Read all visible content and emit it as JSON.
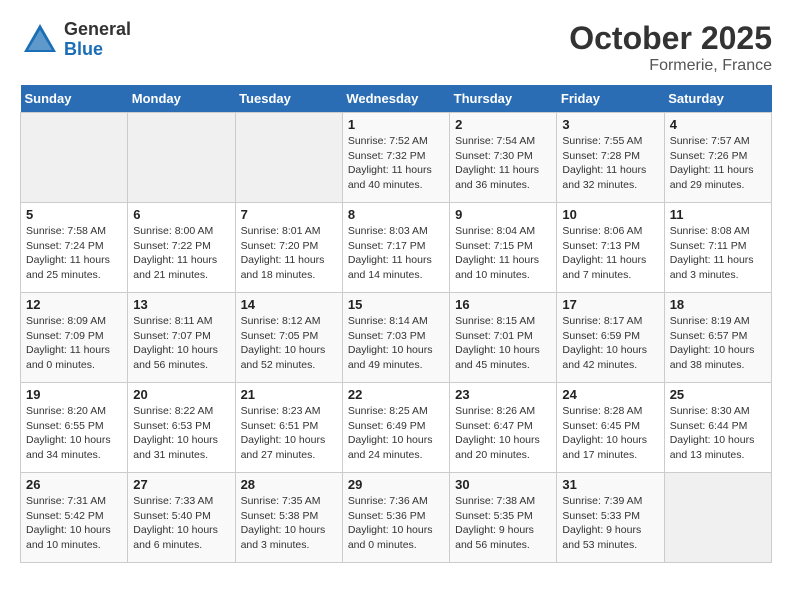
{
  "header": {
    "logo_line1": "General",
    "logo_line2": "Blue",
    "month_title": "October 2025",
    "location": "Formerie, France"
  },
  "calendar": {
    "weekdays": [
      "Sunday",
      "Monday",
      "Tuesday",
      "Wednesday",
      "Thursday",
      "Friday",
      "Saturday"
    ],
    "weeks": [
      [
        {
          "day": "",
          "info": ""
        },
        {
          "day": "",
          "info": ""
        },
        {
          "day": "",
          "info": ""
        },
        {
          "day": "1",
          "info": "Sunrise: 7:52 AM\nSunset: 7:32 PM\nDaylight: 11 hours and 40 minutes."
        },
        {
          "day": "2",
          "info": "Sunrise: 7:54 AM\nSunset: 7:30 PM\nDaylight: 11 hours and 36 minutes."
        },
        {
          "day": "3",
          "info": "Sunrise: 7:55 AM\nSunset: 7:28 PM\nDaylight: 11 hours and 32 minutes."
        },
        {
          "day": "4",
          "info": "Sunrise: 7:57 AM\nSunset: 7:26 PM\nDaylight: 11 hours and 29 minutes."
        }
      ],
      [
        {
          "day": "5",
          "info": "Sunrise: 7:58 AM\nSunset: 7:24 PM\nDaylight: 11 hours and 25 minutes."
        },
        {
          "day": "6",
          "info": "Sunrise: 8:00 AM\nSunset: 7:22 PM\nDaylight: 11 hours and 21 minutes."
        },
        {
          "day": "7",
          "info": "Sunrise: 8:01 AM\nSunset: 7:20 PM\nDaylight: 11 hours and 18 minutes."
        },
        {
          "day": "8",
          "info": "Sunrise: 8:03 AM\nSunset: 7:17 PM\nDaylight: 11 hours and 14 minutes."
        },
        {
          "day": "9",
          "info": "Sunrise: 8:04 AM\nSunset: 7:15 PM\nDaylight: 11 hours and 10 minutes."
        },
        {
          "day": "10",
          "info": "Sunrise: 8:06 AM\nSunset: 7:13 PM\nDaylight: 11 hours and 7 minutes."
        },
        {
          "day": "11",
          "info": "Sunrise: 8:08 AM\nSunset: 7:11 PM\nDaylight: 11 hours and 3 minutes."
        }
      ],
      [
        {
          "day": "12",
          "info": "Sunrise: 8:09 AM\nSunset: 7:09 PM\nDaylight: 11 hours and 0 minutes."
        },
        {
          "day": "13",
          "info": "Sunrise: 8:11 AM\nSunset: 7:07 PM\nDaylight: 10 hours and 56 minutes."
        },
        {
          "day": "14",
          "info": "Sunrise: 8:12 AM\nSunset: 7:05 PM\nDaylight: 10 hours and 52 minutes."
        },
        {
          "day": "15",
          "info": "Sunrise: 8:14 AM\nSunset: 7:03 PM\nDaylight: 10 hours and 49 minutes."
        },
        {
          "day": "16",
          "info": "Sunrise: 8:15 AM\nSunset: 7:01 PM\nDaylight: 10 hours and 45 minutes."
        },
        {
          "day": "17",
          "info": "Sunrise: 8:17 AM\nSunset: 6:59 PM\nDaylight: 10 hours and 42 minutes."
        },
        {
          "day": "18",
          "info": "Sunrise: 8:19 AM\nSunset: 6:57 PM\nDaylight: 10 hours and 38 minutes."
        }
      ],
      [
        {
          "day": "19",
          "info": "Sunrise: 8:20 AM\nSunset: 6:55 PM\nDaylight: 10 hours and 34 minutes."
        },
        {
          "day": "20",
          "info": "Sunrise: 8:22 AM\nSunset: 6:53 PM\nDaylight: 10 hours and 31 minutes."
        },
        {
          "day": "21",
          "info": "Sunrise: 8:23 AM\nSunset: 6:51 PM\nDaylight: 10 hours and 27 minutes."
        },
        {
          "day": "22",
          "info": "Sunrise: 8:25 AM\nSunset: 6:49 PM\nDaylight: 10 hours and 24 minutes."
        },
        {
          "day": "23",
          "info": "Sunrise: 8:26 AM\nSunset: 6:47 PM\nDaylight: 10 hours and 20 minutes."
        },
        {
          "day": "24",
          "info": "Sunrise: 8:28 AM\nSunset: 6:45 PM\nDaylight: 10 hours and 17 minutes."
        },
        {
          "day": "25",
          "info": "Sunrise: 8:30 AM\nSunset: 6:44 PM\nDaylight: 10 hours and 13 minutes."
        }
      ],
      [
        {
          "day": "26",
          "info": "Sunrise: 7:31 AM\nSunset: 5:42 PM\nDaylight: 10 hours and 10 minutes."
        },
        {
          "day": "27",
          "info": "Sunrise: 7:33 AM\nSunset: 5:40 PM\nDaylight: 10 hours and 6 minutes."
        },
        {
          "day": "28",
          "info": "Sunrise: 7:35 AM\nSunset: 5:38 PM\nDaylight: 10 hours and 3 minutes."
        },
        {
          "day": "29",
          "info": "Sunrise: 7:36 AM\nSunset: 5:36 PM\nDaylight: 10 hours and 0 minutes."
        },
        {
          "day": "30",
          "info": "Sunrise: 7:38 AM\nSunset: 5:35 PM\nDaylight: 9 hours and 56 minutes."
        },
        {
          "day": "31",
          "info": "Sunrise: 7:39 AM\nSunset: 5:33 PM\nDaylight: 9 hours and 53 minutes."
        },
        {
          "day": "",
          "info": ""
        }
      ]
    ]
  }
}
